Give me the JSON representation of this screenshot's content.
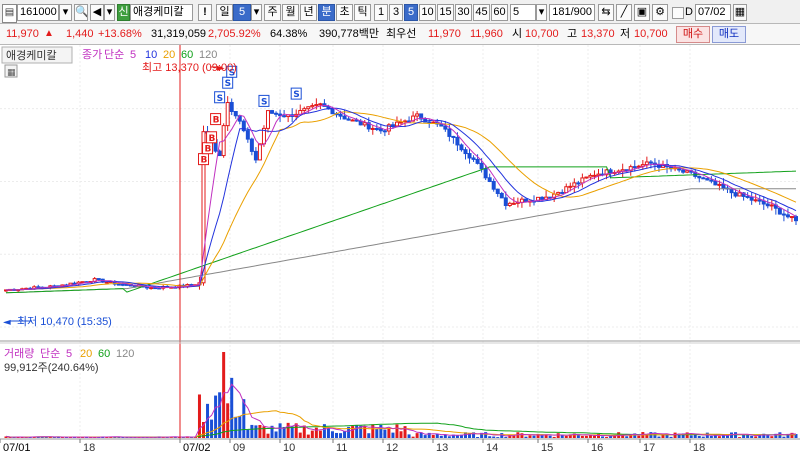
{
  "toolbar": {
    "code": "161000",
    "name": "애경케미칼",
    "sin_badge": "신",
    "alert": "!",
    "periods": [
      "일",
      "5",
      "주",
      "월",
      "년",
      "분",
      "초",
      "틱"
    ],
    "intervals": [
      "1",
      "3",
      "5",
      "10",
      "15",
      "30",
      "45",
      "60"
    ],
    "interval_value": "5",
    "page": "181/900",
    "date_checkbox_label": "D",
    "date": "07/02"
  },
  "info": {
    "price": "11,970",
    "arrow": "▲",
    "change": "1,440",
    "rate": "+13.68%",
    "volume": "31,319,059",
    "vol_rate": "2,705.92%",
    "turnover": "64.38%",
    "amount": "390,778백만",
    "best_label": "최우선",
    "best_ask": "11,970",
    "best_bid": "11,960",
    "open_label": "시",
    "open": "10,700",
    "high_label": "고",
    "high": "13,370",
    "low_label": "저",
    "low": "10,700",
    "buy": "매수",
    "sell": "매도"
  },
  "legend": {
    "name": "애경케미칼",
    "price_label": "종가",
    "ma_label": "단순",
    "ma_periods": [
      "5",
      "10",
      "20",
      "60",
      "120"
    ],
    "volume_label": "거래량",
    "volume_value": "99,912주(240.64%)"
  },
  "annotations": {
    "high": "최고 13,370 (09:00)",
    "low": "최저 10,470 (15:35)"
  },
  "signals": {
    "buy": "B",
    "sell": "S"
  },
  "colors": {
    "up": "#e31b1b",
    "down": "#1a4fd6",
    "ma5": "#c030c0",
    "ma10": "#2233dd",
    "ma20": "#eaa000",
    "ma60": "#11a11a",
    "ma120": "#888888",
    "selected": "#3a6bc9"
  },
  "chart_data": {
    "type": "candlestick",
    "interval": "5분",
    "y_range": [
      10000,
      13600
    ],
    "y_grid": [
      10000,
      11000,
      12000,
      13000
    ],
    "volume_range": [
      0,
      415000
    ],
    "x_labels": [
      "07/01",
      "18",
      "07/02",
      "09",
      "10",
      "11",
      "12",
      "13",
      "14",
      "15",
      "16",
      "17",
      "18"
    ],
    "high": 13370,
    "low": 10470,
    "current_volume": 99912
  }
}
